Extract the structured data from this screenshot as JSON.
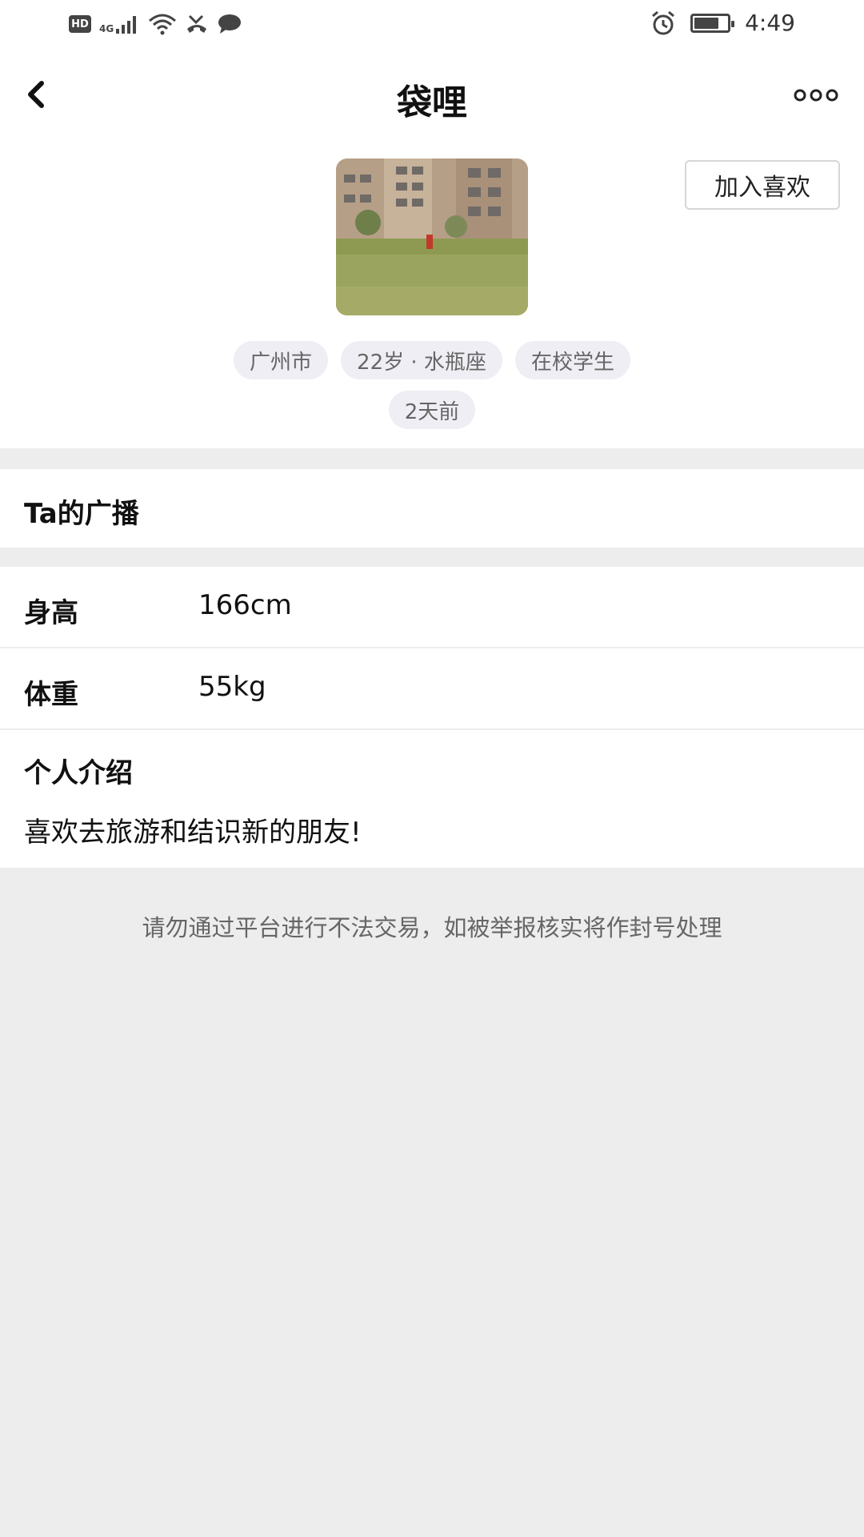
{
  "status_bar": {
    "time": "4:49",
    "hd": "HD",
    "network": "4G",
    "icons": [
      "hd-icon",
      "signal-icon",
      "wifi-icon",
      "missed-call-icon",
      "message-icon",
      "alarm-icon",
      "battery-icon"
    ],
    "battery_level": 0.75
  },
  "navbar": {
    "title": "袋哩",
    "back_icon": "chevron-left-icon",
    "more_icon": "more-dots-icon"
  },
  "profile": {
    "like_button": "加入喜欢",
    "tags": [
      "广州市",
      "22岁 · 水瓶座",
      "在校学生"
    ],
    "time_ago": "2天前"
  },
  "broadcast": {
    "title": "Ta的广播"
  },
  "details": {
    "height_label": "身高",
    "height_value": "166cm",
    "weight_label": "体重",
    "weight_value": "55kg"
  },
  "intro": {
    "title": "个人介绍",
    "text": "喜欢去旅游和结识新的朋友!"
  },
  "notice": "请勿通过平台进行不法交易，如被举报核实将作封号处理",
  "colors": {
    "background": "#ededed",
    "card": "#ffffff",
    "tag_bg": "#eeeef4"
  }
}
